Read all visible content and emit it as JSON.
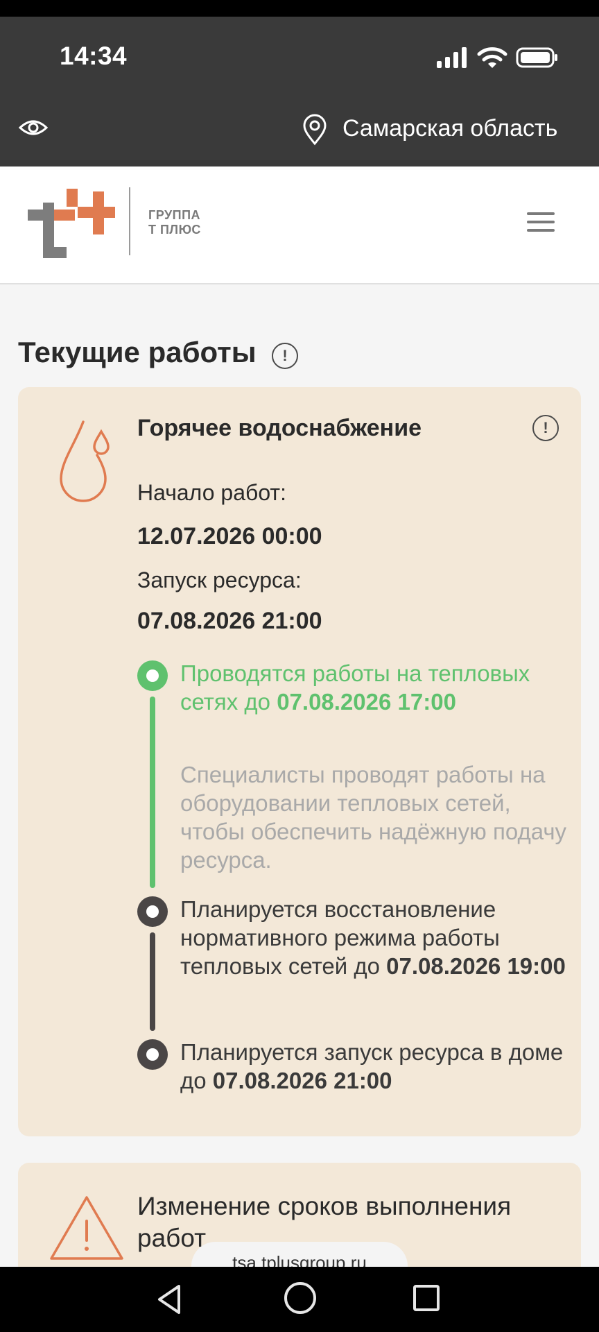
{
  "status": {
    "time": "14:34"
  },
  "region": {
    "name": "Самарская область"
  },
  "brand": {
    "line1": "ГРУППА",
    "line2": "Т ПЛЮС"
  },
  "section": {
    "title": "Текущие работы"
  },
  "card": {
    "title": "Горячее водоснабжение",
    "start_label": "Начало работ:",
    "start_value": "12.07.2026 00:00",
    "launch_label": "Запуск ресурса:",
    "launch_value": "07.08.2026 21:00",
    "timeline": [
      {
        "text": "Проводятся работы на тепловых сетях до",
        "date": "07.08.2026 17:00",
        "desc": "Специалисты проводят работы на оборудовании тепловых сетей, чтобы обеспечить надёжную подачу ресурса."
      },
      {
        "text": "Планируется восстановление нормативного режима работы тепловых сетей до",
        "date": "07.08.2026 19:00"
      },
      {
        "text": "Планируется запуск ресурса в доме до",
        "date": "07.08.2026 21:00"
      }
    ]
  },
  "card2": {
    "title": "Изменение сроков выполнения работ"
  },
  "browser": {
    "url": "tsa.tplusgroup.ru"
  },
  "colors": {
    "active": "#5fc16e",
    "accent": "#e07b50",
    "card_bg": "#f3e8d8",
    "bar_bg": "#3a3a3a"
  }
}
